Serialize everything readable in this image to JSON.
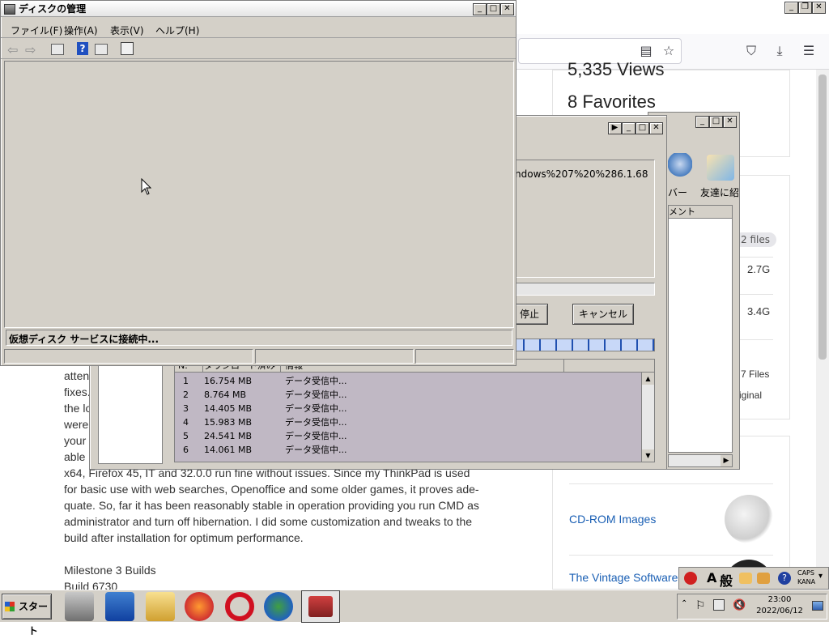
{
  "browser": {
    "stats": {
      "views": "5,335 Views",
      "favorites": "8 Favorites"
    },
    "files_pill": "2 files",
    "file_sizes": [
      "2.7G",
      "3.4G"
    ],
    "files_label": "7 Files",
    "original_label": "riginal",
    "article_prefixes": [
      "atten",
      "fixes.",
      "the lo",
      "were",
      "your",
      "able"
    ],
    "article_lines": [
      "x64, Firefox 45, IT and 32.0.0 run fine without issues. Since my ThinkPad is used",
      "for basic use with web searches, Openoffice and some older games, it proves ade-",
      "quate. So, far it has been reasonably stable in operation providing you run CMD as",
      "administrator and turn off hibernation. I did some customization and tweaks to the",
      "build after installation for optimum performance."
    ],
    "milestone": "Milestone 3 Builds",
    "build": "Build 6730",
    "links": [
      "CD-ROM Images",
      "The Vintage Software"
    ]
  },
  "disk_window": {
    "title": "ディスクの管理",
    "menu": [
      "ファイル(F)",
      "操作(A)",
      "表示(V)",
      "ヘルプ(H)"
    ],
    "status": "仮想ディスク サービスに接続中..."
  },
  "download_window": {
    "url_fragment": "ndows%207%20%286.1.68",
    "stop_label": "停止",
    "cancel_label": "キャンセル",
    "columns": [
      "N.",
      "ダウンロード済み",
      "情報"
    ],
    "rows": [
      {
        "n": "1",
        "size": "16.754 MB",
        "info": "データ受信中..."
      },
      {
        "n": "2",
        "size": "8.764 MB",
        "info": "データ受信中..."
      },
      {
        "n": "3",
        "size": "14.405 MB",
        "info": "データ受信中..."
      },
      {
        "n": "4",
        "size": "15.983 MB",
        "info": "データ受信中..."
      },
      {
        "n": "5",
        "size": "24.541 MB",
        "info": "データ受信中..."
      },
      {
        "n": "6",
        "size": "14.061 MB",
        "info": "データ受信中..."
      }
    ]
  },
  "back_window": {
    "labels": [
      "バー",
      "友達に紹"
    ],
    "column": "メント"
  },
  "taskbar": {
    "start_label": "スタート",
    "ime": [
      "A",
      "般"
    ],
    "caps": "CAPS",
    "kana": "KANA",
    "time": "23:00",
    "date": "2022/06/12"
  }
}
